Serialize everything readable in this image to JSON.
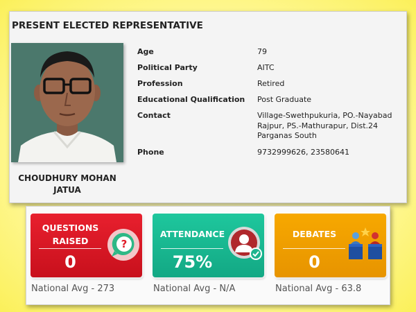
{
  "representative": {
    "section_title": "PRESENT ELECTED REPRESENTATIVE",
    "name": "CHOUDHURY MOHAN JATUA",
    "details": [
      {
        "label": "Age",
        "value": "79"
      },
      {
        "label": "Political Party",
        "value": "AITC"
      },
      {
        "label": "Profession",
        "value": "Retired"
      },
      {
        "label": "Educational Qualification",
        "value": "Post Graduate"
      },
      {
        "label": "Contact",
        "value": "Village-Swethpukuria, PO.-Nayabad Rajpur, PS.-Mathurapur, Dist.24 Parganas South"
      },
      {
        "label": "Phone",
        "value": "9732999626, 23580641"
      }
    ]
  },
  "stats": [
    {
      "label": "QUESTIONS RAISED",
      "value": "0",
      "national_avg": "National Avg - 273",
      "color": "#e11d2a",
      "icon": "question-bubble-icon"
    },
    {
      "label": "ATTENDANCE",
      "value": "75%",
      "national_avg": "National Avg - N/A",
      "color": "#17b38f",
      "icon": "person-check-icon"
    },
    {
      "label": "DEBATES",
      "value": "0",
      "national_avg": "National Avg - 63.8",
      "color": "#f0a000",
      "icon": "podium-debate-icon"
    }
  ]
}
